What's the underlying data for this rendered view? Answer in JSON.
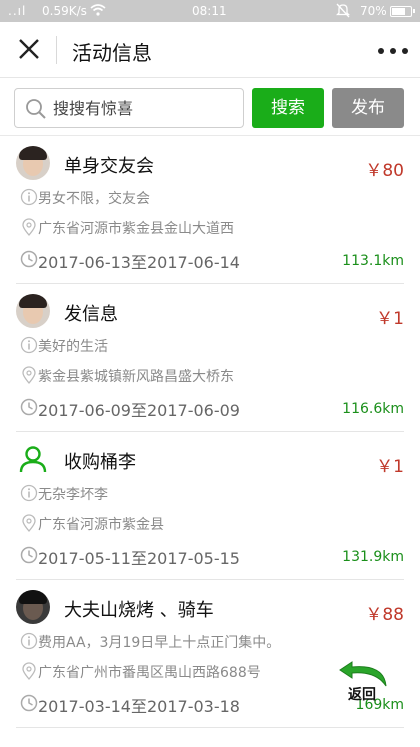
{
  "status_bar": {
    "signal": "..ıl",
    "speed": "0.59K/s",
    "time": "08:11",
    "battery": "70%",
    "battery_level": 0.7
  },
  "header": {
    "title": "活动信息"
  },
  "search": {
    "placeholder": "搜搜有惊喜",
    "value": "",
    "search_label": "搜索",
    "publish_label": "发布"
  },
  "colors": {
    "accent_green": "#1aad19",
    "price_red": "#c0392b",
    "publish_gray": "#8a8a8a",
    "distance_green": "#1a8f1a"
  },
  "events": [
    {
      "title": "单身交友会",
      "price": "￥80",
      "description": "男女不限，交友会",
      "address": "广东省河源市紫金县金山大道西",
      "dates": "2017-06-13至2017-06-14",
      "distance": "113.1km",
      "avatar": "photo"
    },
    {
      "title": "发信息",
      "price": "￥1",
      "description": "美好的生活",
      "address": "紫金县紫城镇新风路昌盛大桥东",
      "dates": "2017-06-09至2017-06-09",
      "distance": "116.6km",
      "avatar": "photo"
    },
    {
      "title": "收购桶李",
      "price": "￥1",
      "description": "无杂李坏李",
      "address": "广东省河源市紫金县",
      "dates": "2017-05-11至2017-05-15",
      "distance": "131.9km",
      "avatar": "user-icon"
    },
    {
      "title": "大夫山烧烤 、骑车",
      "price": "￥88",
      "description": "费用AA，3月19日早上十点正门集中。",
      "address": "广东省广州市番禺区禺山西路688号",
      "dates": "2017-03-14至2017-03-18",
      "distance": "169km",
      "avatar": "photo-dark"
    }
  ],
  "back_button": {
    "label": "返回"
  }
}
